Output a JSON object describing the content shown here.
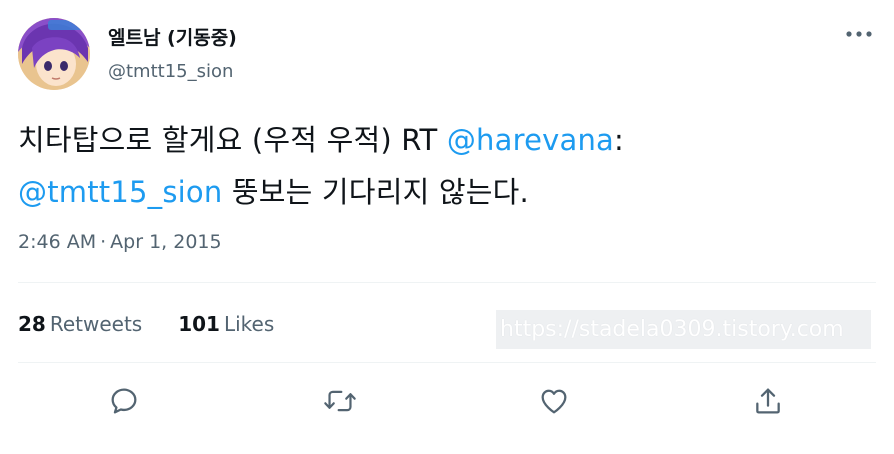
{
  "author": {
    "display_name": "엘트남 (기동중)",
    "handle": "@tmtt15_sion"
  },
  "tweet": {
    "text_part1": "치타탑으로 할게요 (우적 우적) RT ",
    "mention1": "@harevana",
    "text_part2": ":",
    "mention2": "@tmtt15_sion",
    "text_part3": " 뚱보는 기다리지 않는다."
  },
  "meta": {
    "time": "2:46 AM",
    "separator": "·",
    "date": "Apr 1, 2015"
  },
  "stats": {
    "retweets_count": "28",
    "retweets_label": "Retweets",
    "likes_count": "101",
    "likes_label": "Likes"
  },
  "watermark": "https://stadela0309.tistory.com",
  "icons": {
    "more": "more-horizontal-icon",
    "reply": "reply-icon",
    "retweet": "retweet-icon",
    "like": "heart-icon",
    "share": "share-icon"
  },
  "colors": {
    "link": "#1d9bf0",
    "secondary_text": "#536471",
    "primary_text": "#0f1419"
  }
}
